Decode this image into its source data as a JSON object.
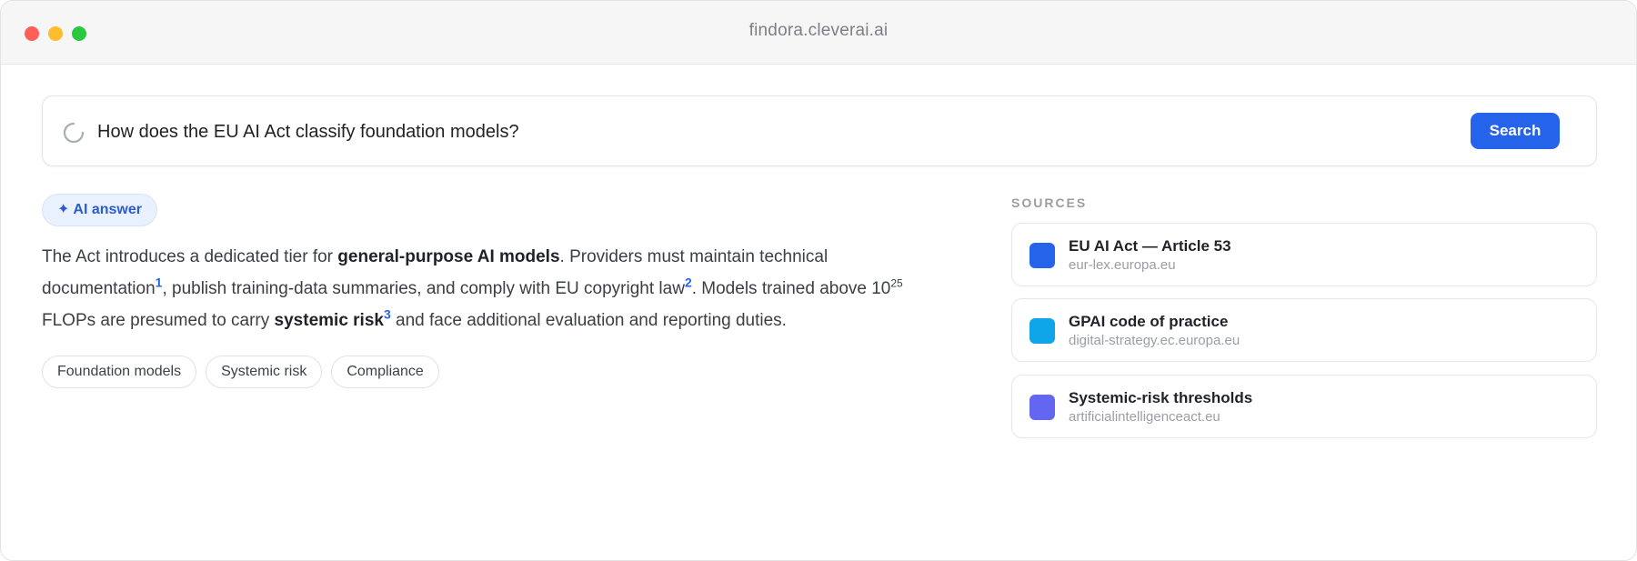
{
  "window": {
    "url": "findora.cleverai.ai"
  },
  "search": {
    "query": "How does the EU AI Act classify foundation models?",
    "button_label": "Search"
  },
  "answer": {
    "badge_icon": "sparkle-icon",
    "badge_label": "AI answer",
    "segments": {
      "s1": "The Act introduces a dedicated tier for ",
      "b1": "general-purpose AI models",
      "s2": ". Providers must maintain technical documentation",
      "c1": "1",
      "s3": ", publish training-data summaries, and comply with EU copyright law",
      "c2": "2",
      "s4": ". Models trained above 10",
      "exp": "25",
      "s5": " FLOPs are presumed to carry ",
      "b2": "systemic risk",
      "c3": "3",
      "s6": " and face additional evaluation and reporting duties."
    },
    "tags": [
      "Foundation models",
      "Systemic risk",
      "Compliance"
    ]
  },
  "sources": {
    "label": "SOURCES",
    "items": [
      {
        "title": "EU AI Act — Article 53",
        "domain": "eur-lex.europa.eu",
        "color": "#2563eb"
      },
      {
        "title": "GPAI code of practice",
        "domain": "digital-strategy.ec.europa.eu",
        "color": "#0ea5e9"
      },
      {
        "title": "Systemic-risk thresholds",
        "domain": "artificialintelligenceact.eu",
        "color": "#6366f1"
      }
    ]
  },
  "colors": {
    "accent": "#2563eb",
    "traffic_red": "#ff5f57",
    "traffic_yellow": "#febc2e",
    "traffic_green": "#28c840"
  }
}
